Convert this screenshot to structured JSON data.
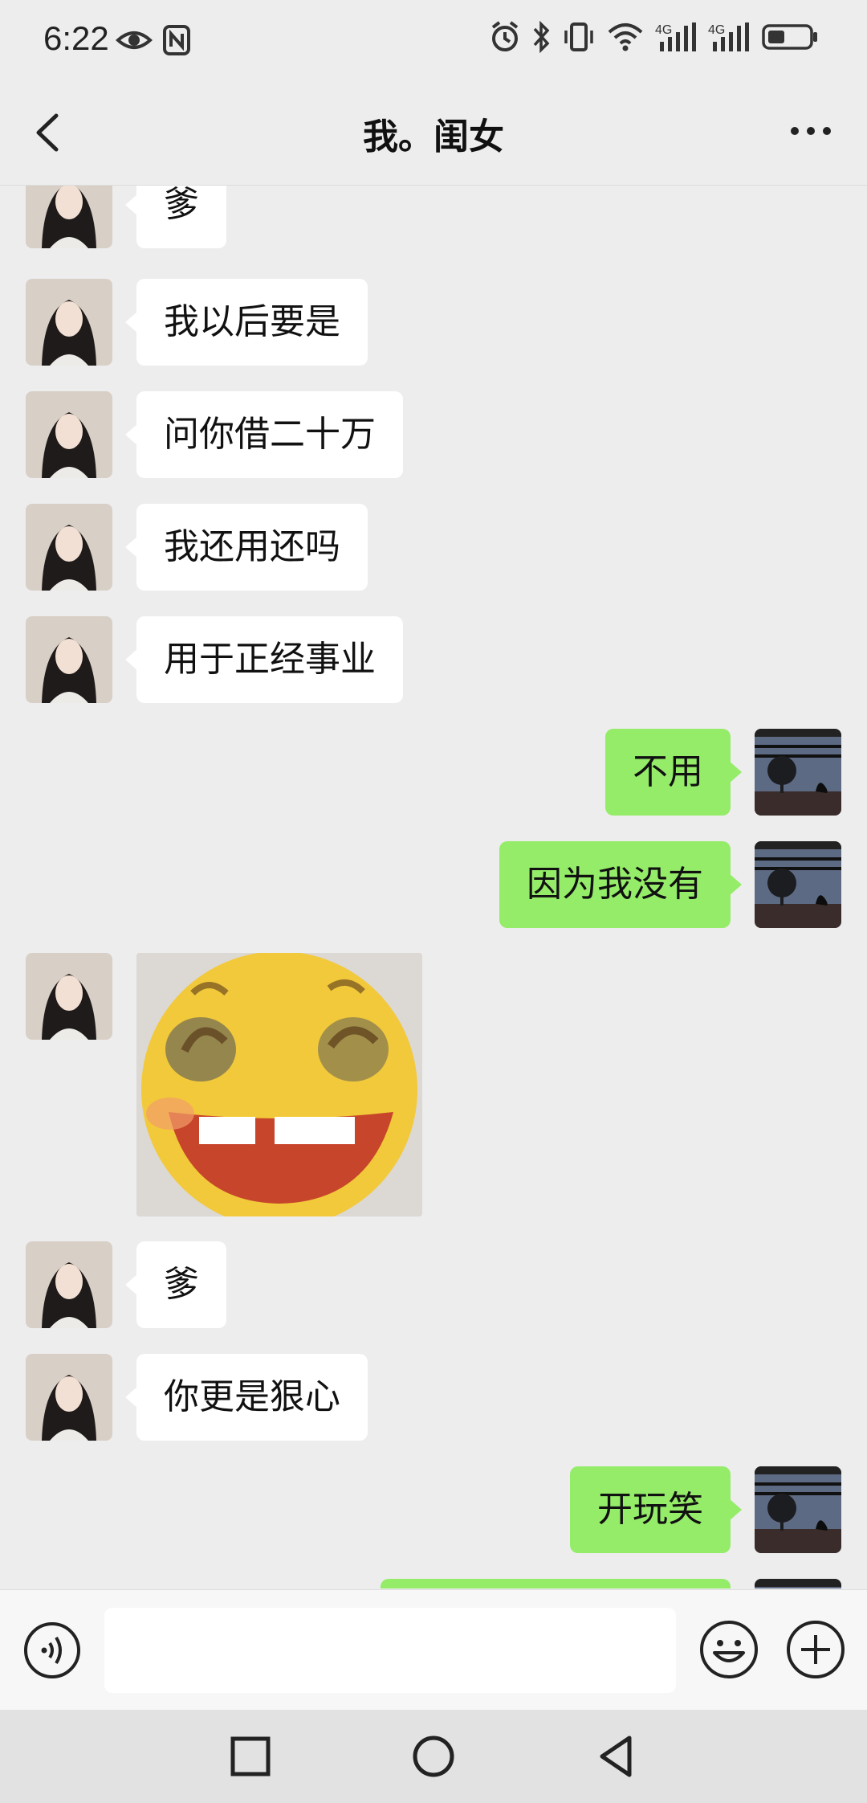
{
  "status_bar": {
    "time": "6:22",
    "left_icons": [
      "eye-icon",
      "nfc-icon"
    ],
    "right_icons": [
      "alarm-icon",
      "bluetooth-icon",
      "vibrate-icon",
      "wifi-icon",
      "signal-4g-icon",
      "signal-4g-icon",
      "battery-icon"
    ],
    "network_label_1": "4G",
    "network_label_2": "4G"
  },
  "header": {
    "title": "我。闺女",
    "back_icon": "chevron-left-icon",
    "more_icon": "more-icon"
  },
  "messages": [
    {
      "side": "left",
      "type": "text",
      "text": "爹"
    },
    {
      "side": "left",
      "type": "text",
      "text": "我以后要是"
    },
    {
      "side": "left",
      "type": "text",
      "text": "问你借二十万"
    },
    {
      "side": "left",
      "type": "text",
      "text": "我还用还吗"
    },
    {
      "side": "left",
      "type": "text",
      "text": "用于正经事业"
    },
    {
      "side": "right",
      "type": "text",
      "text": "不用"
    },
    {
      "side": "right",
      "type": "text",
      "text": "因为我没有"
    },
    {
      "side": "left",
      "type": "sticker",
      "sticker": "smiling-emoji-sticker"
    },
    {
      "side": "left",
      "type": "text",
      "text": "爹"
    },
    {
      "side": "left",
      "type": "text",
      "text": "你更是狠心"
    },
    {
      "side": "right",
      "type": "text",
      "text": "开玩笑"
    },
    {
      "side": "right",
      "type": "text",
      "text": ""
    }
  ],
  "input_bar": {
    "value": "",
    "voice_icon": "voice-icon",
    "emoji_icon": "emoji-icon",
    "plus_icon": "plus-icon"
  },
  "system_nav": {
    "icons": [
      "recents-icon",
      "home-icon",
      "back-icon"
    ]
  },
  "colors": {
    "background": "#EDEDED",
    "incoming_bubble": "#FFFFFF",
    "outgoing_bubble": "#95EC69"
  }
}
